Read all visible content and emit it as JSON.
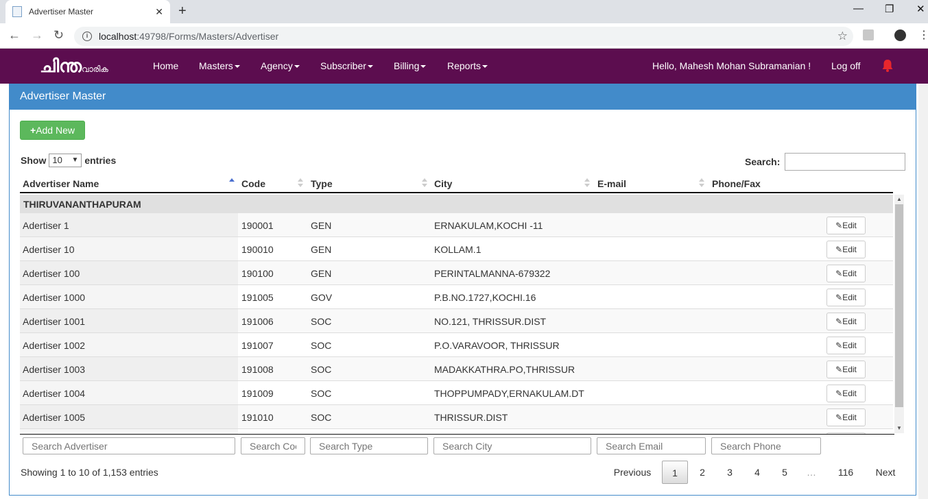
{
  "browser": {
    "tab_title": "Advertiser Master",
    "url_host": "localhost",
    "url_path": ":49798/Forms/Masters/Advertiser"
  },
  "navbar": {
    "logo_main": "ചിന്ത",
    "logo_sub": "വാരിക",
    "items": [
      {
        "label": "Home",
        "dropdown": false
      },
      {
        "label": "Masters",
        "dropdown": true
      },
      {
        "label": "Agency",
        "dropdown": true
      },
      {
        "label": "Subscriber",
        "dropdown": true
      },
      {
        "label": "Billing",
        "dropdown": true
      },
      {
        "label": "Reports",
        "dropdown": true
      }
    ],
    "greeting": "Hello, Mahesh Mohan Subramanian !",
    "logoff": "Log off",
    "bg_color": "#5c0d4f"
  },
  "panel": {
    "title": "Advertiser Master",
    "add_button": "Add New"
  },
  "table_controls": {
    "show_label": "Show",
    "entries_value": "10",
    "entries_label": "entries",
    "search_label": "Search:"
  },
  "table": {
    "columns": [
      "Advertiser Name",
      "Code",
      "Type",
      "City",
      "E-mail",
      "Phone/Fax"
    ],
    "group": "THIRUVANANTHAPURAM",
    "edit_label": "Edit",
    "rows": [
      {
        "name": "Adertiser 1",
        "code": "190001",
        "type": "GEN",
        "city": "ERNAKULAM,KOCHI -11"
      },
      {
        "name": "Adertiser 10",
        "code": "190010",
        "type": "GEN",
        "city": "KOLLAM.1"
      },
      {
        "name": "Adertiser 100",
        "code": "190100",
        "type": "GEN",
        "city": "PERINTALMANNA-679322"
      },
      {
        "name": "Adertiser 1000",
        "code": "191005",
        "type": "GOV",
        "city": "P.B.NO.1727,KOCHI.16"
      },
      {
        "name": "Adertiser 1001",
        "code": "191006",
        "type": "SOC",
        "city": "NO.121, THRISSUR.DIST"
      },
      {
        "name": "Adertiser 1002",
        "code": "191007",
        "type": "SOC",
        "city": "P.O.VARAVOOR, THRISSUR"
      },
      {
        "name": "Adertiser 1003",
        "code": "191008",
        "type": "SOC",
        "city": "MADAKKATHRA.PO,THRISSUR"
      },
      {
        "name": "Adertiser 1004",
        "code": "191009",
        "type": "SOC",
        "city": "THOPPUMPADY,ERNAKULAM.DT"
      },
      {
        "name": "Adertiser 1005",
        "code": "191010",
        "type": "SOC",
        "city": "THRISSUR.DIST"
      }
    ],
    "footer_placeholders": [
      "Search Advertiser",
      "Search Coc",
      "Search Type",
      "Search City",
      "Search Email",
      "Search Phone"
    ]
  },
  "pagination": {
    "info": "Showing 1 to 10 of 1,153 entries",
    "previous": "Previous",
    "pages": [
      "1",
      "2",
      "3",
      "4",
      "5",
      "…",
      "116"
    ],
    "current": "1",
    "next": "Next"
  }
}
